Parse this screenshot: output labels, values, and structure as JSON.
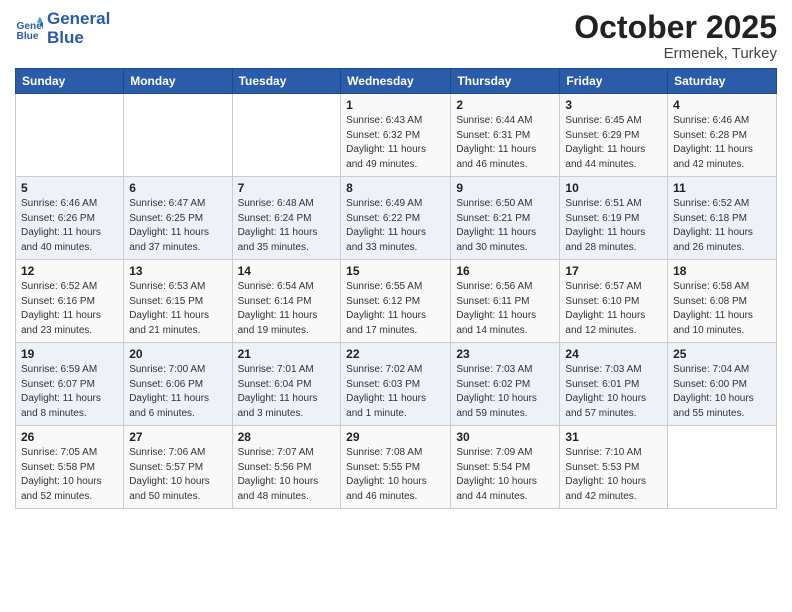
{
  "logo": {
    "line1": "General",
    "line2": "Blue"
  },
  "title": "October 2025",
  "subtitle": "Ermenek, Turkey",
  "days_header": [
    "Sunday",
    "Monday",
    "Tuesday",
    "Wednesday",
    "Thursday",
    "Friday",
    "Saturday"
  ],
  "weeks": [
    [
      {
        "num": "",
        "detail": ""
      },
      {
        "num": "",
        "detail": ""
      },
      {
        "num": "",
        "detail": ""
      },
      {
        "num": "1",
        "detail": "Sunrise: 6:43 AM\nSunset: 6:32 PM\nDaylight: 11 hours\nand 49 minutes."
      },
      {
        "num": "2",
        "detail": "Sunrise: 6:44 AM\nSunset: 6:31 PM\nDaylight: 11 hours\nand 46 minutes."
      },
      {
        "num": "3",
        "detail": "Sunrise: 6:45 AM\nSunset: 6:29 PM\nDaylight: 11 hours\nand 44 minutes."
      },
      {
        "num": "4",
        "detail": "Sunrise: 6:46 AM\nSunset: 6:28 PM\nDaylight: 11 hours\nand 42 minutes."
      }
    ],
    [
      {
        "num": "5",
        "detail": "Sunrise: 6:46 AM\nSunset: 6:26 PM\nDaylight: 11 hours\nand 40 minutes."
      },
      {
        "num": "6",
        "detail": "Sunrise: 6:47 AM\nSunset: 6:25 PM\nDaylight: 11 hours\nand 37 minutes."
      },
      {
        "num": "7",
        "detail": "Sunrise: 6:48 AM\nSunset: 6:24 PM\nDaylight: 11 hours\nand 35 minutes."
      },
      {
        "num": "8",
        "detail": "Sunrise: 6:49 AM\nSunset: 6:22 PM\nDaylight: 11 hours\nand 33 minutes."
      },
      {
        "num": "9",
        "detail": "Sunrise: 6:50 AM\nSunset: 6:21 PM\nDaylight: 11 hours\nand 30 minutes."
      },
      {
        "num": "10",
        "detail": "Sunrise: 6:51 AM\nSunset: 6:19 PM\nDaylight: 11 hours\nand 28 minutes."
      },
      {
        "num": "11",
        "detail": "Sunrise: 6:52 AM\nSunset: 6:18 PM\nDaylight: 11 hours\nand 26 minutes."
      }
    ],
    [
      {
        "num": "12",
        "detail": "Sunrise: 6:52 AM\nSunset: 6:16 PM\nDaylight: 11 hours\nand 23 minutes."
      },
      {
        "num": "13",
        "detail": "Sunrise: 6:53 AM\nSunset: 6:15 PM\nDaylight: 11 hours\nand 21 minutes."
      },
      {
        "num": "14",
        "detail": "Sunrise: 6:54 AM\nSunset: 6:14 PM\nDaylight: 11 hours\nand 19 minutes."
      },
      {
        "num": "15",
        "detail": "Sunrise: 6:55 AM\nSunset: 6:12 PM\nDaylight: 11 hours\nand 17 minutes."
      },
      {
        "num": "16",
        "detail": "Sunrise: 6:56 AM\nSunset: 6:11 PM\nDaylight: 11 hours\nand 14 minutes."
      },
      {
        "num": "17",
        "detail": "Sunrise: 6:57 AM\nSunset: 6:10 PM\nDaylight: 11 hours\nand 12 minutes."
      },
      {
        "num": "18",
        "detail": "Sunrise: 6:58 AM\nSunset: 6:08 PM\nDaylight: 11 hours\nand 10 minutes."
      }
    ],
    [
      {
        "num": "19",
        "detail": "Sunrise: 6:59 AM\nSunset: 6:07 PM\nDaylight: 11 hours\nand 8 minutes."
      },
      {
        "num": "20",
        "detail": "Sunrise: 7:00 AM\nSunset: 6:06 PM\nDaylight: 11 hours\nand 6 minutes."
      },
      {
        "num": "21",
        "detail": "Sunrise: 7:01 AM\nSunset: 6:04 PM\nDaylight: 11 hours\nand 3 minutes."
      },
      {
        "num": "22",
        "detail": "Sunrise: 7:02 AM\nSunset: 6:03 PM\nDaylight: 11 hours\nand 1 minute."
      },
      {
        "num": "23",
        "detail": "Sunrise: 7:03 AM\nSunset: 6:02 PM\nDaylight: 10 hours\nand 59 minutes."
      },
      {
        "num": "24",
        "detail": "Sunrise: 7:03 AM\nSunset: 6:01 PM\nDaylight: 10 hours\nand 57 minutes."
      },
      {
        "num": "25",
        "detail": "Sunrise: 7:04 AM\nSunset: 6:00 PM\nDaylight: 10 hours\nand 55 minutes."
      }
    ],
    [
      {
        "num": "26",
        "detail": "Sunrise: 7:05 AM\nSunset: 5:58 PM\nDaylight: 10 hours\nand 52 minutes."
      },
      {
        "num": "27",
        "detail": "Sunrise: 7:06 AM\nSunset: 5:57 PM\nDaylight: 10 hours\nand 50 minutes."
      },
      {
        "num": "28",
        "detail": "Sunrise: 7:07 AM\nSunset: 5:56 PM\nDaylight: 10 hours\nand 48 minutes."
      },
      {
        "num": "29",
        "detail": "Sunrise: 7:08 AM\nSunset: 5:55 PM\nDaylight: 10 hours\nand 46 minutes."
      },
      {
        "num": "30",
        "detail": "Sunrise: 7:09 AM\nSunset: 5:54 PM\nDaylight: 10 hours\nand 44 minutes."
      },
      {
        "num": "31",
        "detail": "Sunrise: 7:10 AM\nSunset: 5:53 PM\nDaylight: 10 hours\nand 42 minutes."
      },
      {
        "num": "",
        "detail": ""
      }
    ]
  ]
}
